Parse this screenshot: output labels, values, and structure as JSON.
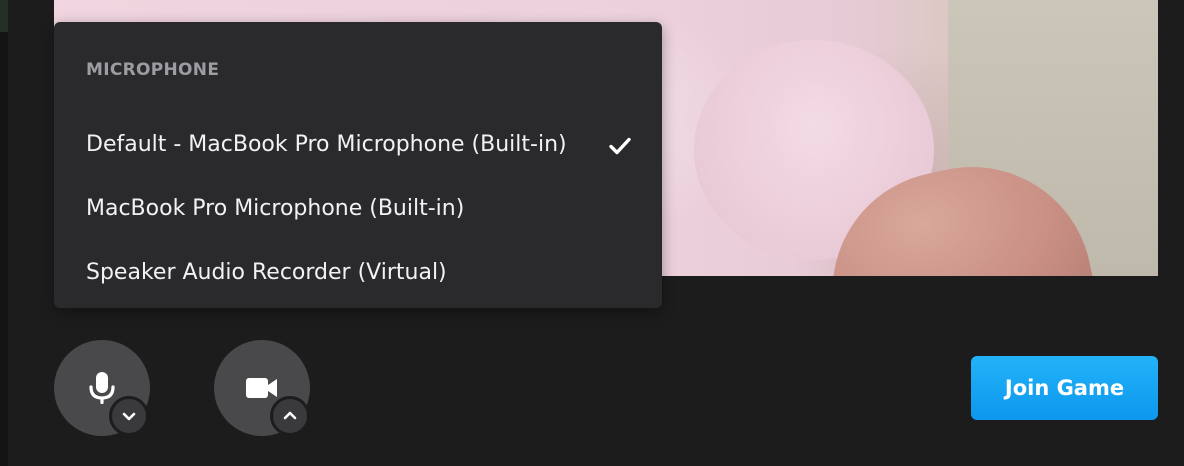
{
  "colors": {
    "background": "#1c1c1d",
    "menu_background": "#2a2a2d",
    "menu_heading": "#9c9ca2",
    "menu_text": "#f2f2f4",
    "control_background": "#49494c",
    "accent": "#12a3f3"
  },
  "microphone_menu": {
    "heading": "MICROPHONE",
    "options": [
      {
        "label": "Default - MacBook Pro Microphone (Built-in)",
        "selected": true
      },
      {
        "label": "MacBook Pro Microphone (Built-in)",
        "selected": false
      },
      {
        "label": "Speaker Audio Recorder (Virtual)",
        "selected": false
      }
    ],
    "selected_icon": "checkmark-icon"
  },
  "controls": {
    "microphone": {
      "icon": "microphone-icon",
      "toggle_icon": "chevron-down-icon"
    },
    "camera": {
      "icon": "video-camera-icon",
      "toggle_icon": "chevron-up-icon"
    }
  },
  "join_button": {
    "label": "Join Game"
  },
  "video_preview": {
    "icon": "camera-preview"
  }
}
